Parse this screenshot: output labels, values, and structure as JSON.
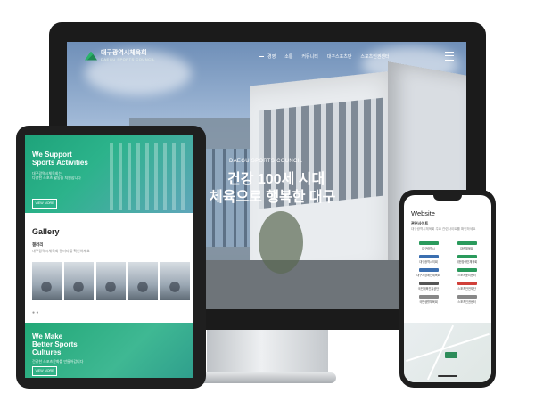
{
  "desktop": {
    "logo": {
      "name": "대구광역시체육회",
      "sub": "DAEGU SPORTS COUNCIL"
    },
    "nav": [
      "경영",
      "소통",
      "커뮤니티",
      "대구스포츠단",
      "스포츠인권센터"
    ],
    "hero": {
      "small": "DAEGU SPORTS COUNCIL",
      "line1": "건강 100세 시대",
      "line2": "체육으로 행복한 대구"
    }
  },
  "tablet": {
    "hero": {
      "line1": "We Support",
      "line2": "Sports Activities",
      "sub1": "대구광역시체육회는",
      "sub2": "다양한 스포츠 활동을 지원합니다",
      "button": "VIEW MORE"
    },
    "gallery": {
      "title": "Gallery",
      "label": "갤러리",
      "desc": "대구광역시체육회 갤러리를 확인하세요",
      "dots": "● ●"
    },
    "section2": {
      "line1": "We Make",
      "line2": "Better Sports",
      "line3": "Cultures",
      "sub": "건강한 스포츠문화를 만들어갑니다",
      "button": "VIEW MORE"
    }
  },
  "phone": {
    "title": "Website",
    "label": "관련사이트",
    "desc": "대구광역시체육회 주요 관련사이트를 확인하세요",
    "sites": [
      {
        "name": "대구광역시",
        "color": "#2a9a5c"
      },
      {
        "name": "대한체육회",
        "color": "#2a9a5c"
      },
      {
        "name": "대구광역시의회",
        "color": "#3b6fb0"
      },
      {
        "name": "대한장애인체육회",
        "color": "#2a9a5c"
      },
      {
        "name": "대구시장애인체육회",
        "color": "#3b6fb0"
      },
      {
        "name": "스포츠윤리센터",
        "color": "#2a9a5c"
      },
      {
        "name": "국민체육진흥공단",
        "color": "#555555"
      },
      {
        "name": "스포츠안전재단",
        "color": "#d0403a"
      },
      {
        "name": "국민생활체육회",
        "color": "#888888"
      },
      {
        "name": "스포츠인권센터",
        "color": "#888888"
      }
    ]
  }
}
